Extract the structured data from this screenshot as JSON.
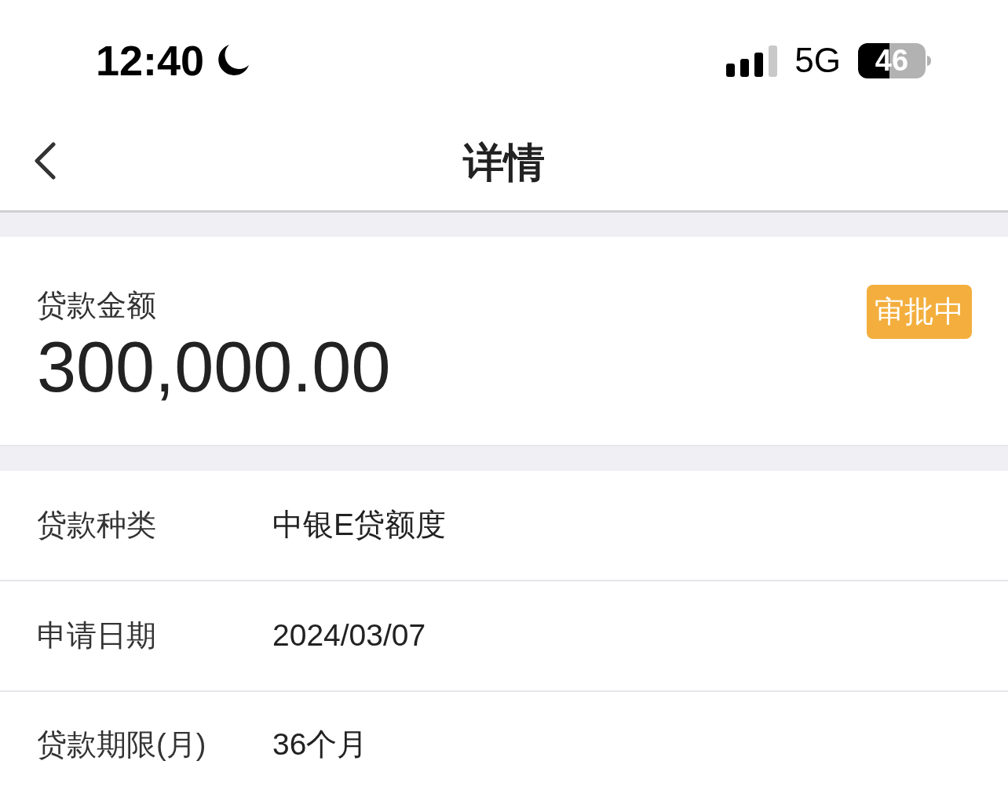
{
  "status_bar": {
    "time": "12:40",
    "network": "5G",
    "battery": "46"
  },
  "nav_bar": {
    "title": "详情"
  },
  "summary": {
    "label": "贷款金额",
    "amount": "300,000.00",
    "status": "审批中"
  },
  "details": [
    {
      "label": "贷款种类",
      "value": "中银E贷额度"
    },
    {
      "label": "申请日期",
      "value": "2024/03/07"
    },
    {
      "label": "贷款期限(月)",
      "value": "36个月"
    }
  ]
}
